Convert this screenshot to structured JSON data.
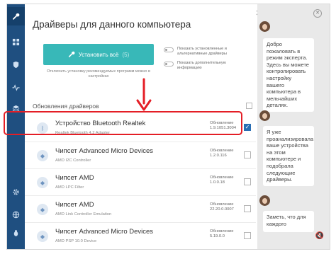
{
  "main": {
    "title": "Драйверы для данного компьютера",
    "install_button": {
      "label": "Установить всё",
      "count": "(5)"
    },
    "install_hint": "Отключить установку рекомендуемых программ можно в настройках",
    "options": [
      "Показать установленные и альтернативные драйверы",
      "Показать дополнительную информацию"
    ],
    "section_title": "Обновления драйверов",
    "drivers": [
      {
        "name": "Устройство Bluetooth Realtek",
        "sub": "Realtek Bluetooth 4.2 Adapter",
        "update_label": "Обновление",
        "version": "1.9.1051.3004",
        "checked": true
      },
      {
        "name": "Чипсет Advanced Micro Devices",
        "sub": "AMD I2C Controller",
        "update_label": "Обновление",
        "version": "1.2.0.116",
        "checked": false
      },
      {
        "name": "Чипсет AMD",
        "sub": "AMD LPC Filter",
        "update_label": "Обновление",
        "version": "1.0.0.18",
        "checked": false
      },
      {
        "name": "Чипсет AMD",
        "sub": "AMD Link Controller Emulation",
        "update_label": "Обновление",
        "version": "22.20.0.0007",
        "checked": false
      },
      {
        "name": "Чипсет Advanced Micro Devices",
        "sub": "AMD PSP 10.0 Device",
        "update_label": "Обновление",
        "version": "5.19.0.0",
        "checked": false
      }
    ]
  },
  "chat": {
    "messages": [
      "Добро пожаловать в режим эксперта. Здесь вы можете контролировать настройку вашего компьютера в мельчайших деталях.",
      "Я уже проанализировала ваше устройства на этом компьютере и подобрала следующие драйверы.",
      "Заметь, что для каждого"
    ]
  },
  "colors": {
    "rail": "#1f4f80",
    "install": "#38b8b8",
    "highlight": "#e41e26",
    "check": "#2a6eb3"
  }
}
